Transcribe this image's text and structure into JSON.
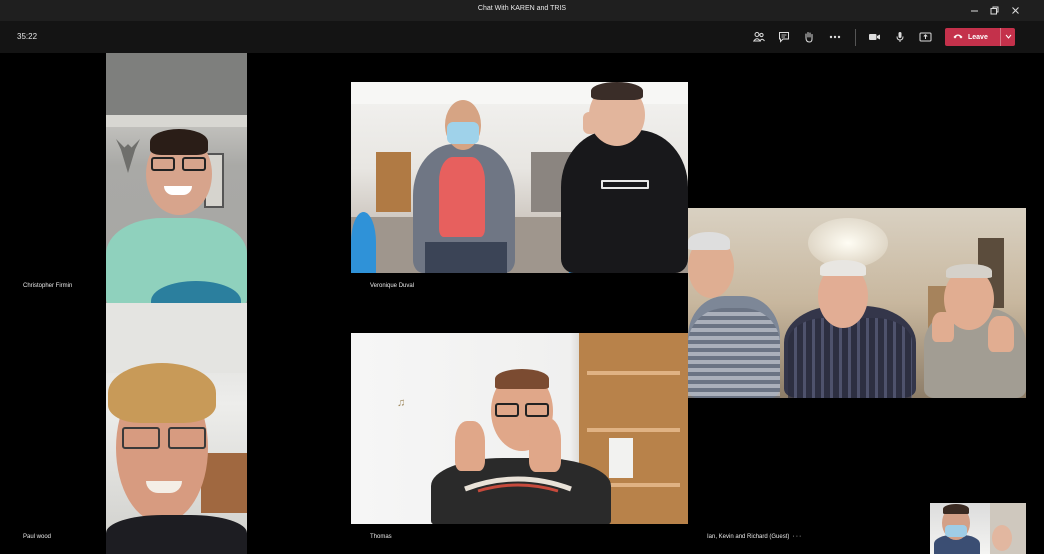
{
  "window": {
    "title": "Chat With KAREN and TRIS"
  },
  "toolbar": {
    "timer": "35:22",
    "leave_label": "Leave",
    "icons": [
      "participants-icon",
      "chat-icon",
      "raise-hand-icon",
      "more-icon",
      "camera-icon",
      "mic-icon",
      "share-icon"
    ]
  },
  "participants": [
    {
      "name": "Christopher Firmin"
    },
    {
      "name": "Paul wood"
    },
    {
      "name": "Veronique Duval"
    },
    {
      "name": "Thomas"
    },
    {
      "name": "Ian, Kevin and Richard (Guest)"
    }
  ],
  "colors": {
    "leave_button": "#c4314b",
    "titlebar": "#1f1f1f",
    "toolbar": "#141414",
    "background": "#000000"
  }
}
